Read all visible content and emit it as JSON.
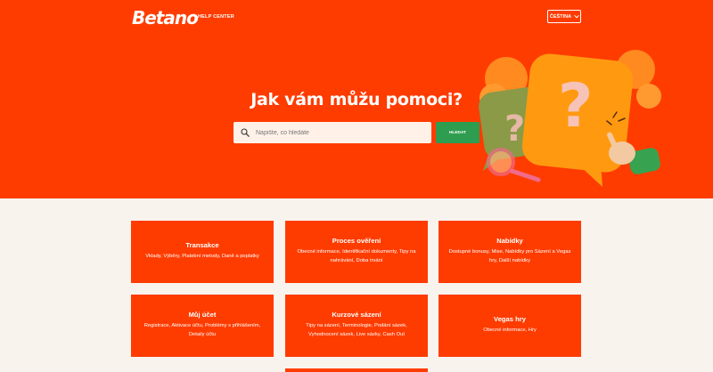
{
  "header": {
    "logo": "Betano",
    "help_center": "HELP CENTER",
    "language": "ČEŠTINA"
  },
  "hero": {
    "title": "Jak vám můžu pomoci?",
    "search_placeholder": "Napište, co hledáte",
    "search_button": "HLEDAT"
  },
  "categories": [
    {
      "title": "Transakce",
      "desc": "Vklady, Výběry, Platební metody, Daně a poplatky"
    },
    {
      "title": "Proces ověření",
      "desc": "Obecné informace, Identifikační dokumenty, Tipy na nahrávání, Doba trvání"
    },
    {
      "title": "Nabídky",
      "desc": "Dostupné bonusy, Mise, Nabídky pro Sázení a Vegas hry, Další nabídky"
    },
    {
      "title": "Můj účet",
      "desc": "Registrace, Aktivace účtu, Problémy s přihlášením, Detaily účtu"
    },
    {
      "title": "Kurzové sázení",
      "desc": "Tipy na sázení, Terminologie, Podání sázek, Vyhodnocení sázek, Live sázky, Cash Out"
    },
    {
      "title": "Vegas hry",
      "desc": "Obecné informace, Hry"
    }
  ],
  "colors": {
    "brand": "#ff3c00",
    "search_button": "#2e9d4f",
    "page_background": "#f9f3ee"
  }
}
